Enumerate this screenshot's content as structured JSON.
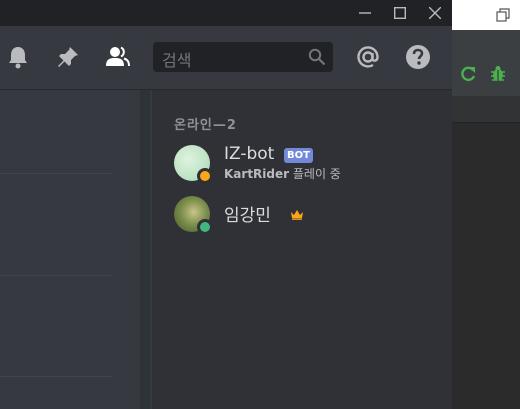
{
  "header": {
    "search_placeholder": "검색"
  },
  "members": {
    "section_title": "온라인—2",
    "items": [
      {
        "name": "IZ-bot",
        "badge": "BOT",
        "activity_game": "KartRider",
        "activity_suffix": " 플레이 중",
        "status": "idle",
        "status_color": "#faa61a"
      },
      {
        "name": "임강민",
        "crown_icon": "crown-icon",
        "status": "online",
        "status_color": "#43b581"
      }
    ]
  },
  "icons": [
    "minimize-icon",
    "maximize-icon",
    "close-icon",
    "bell-icon",
    "pin-icon",
    "members-icon",
    "search-icon",
    "at-icon",
    "help-icon",
    "restore-icon",
    "refresh-icon",
    "bug-icon",
    "crown-icon"
  ],
  "colors": {
    "accent": "#7289da",
    "bot_badge": "#7289da",
    "crown": "#faa61a",
    "online": "#43b581",
    "idle": "#faa61a"
  }
}
